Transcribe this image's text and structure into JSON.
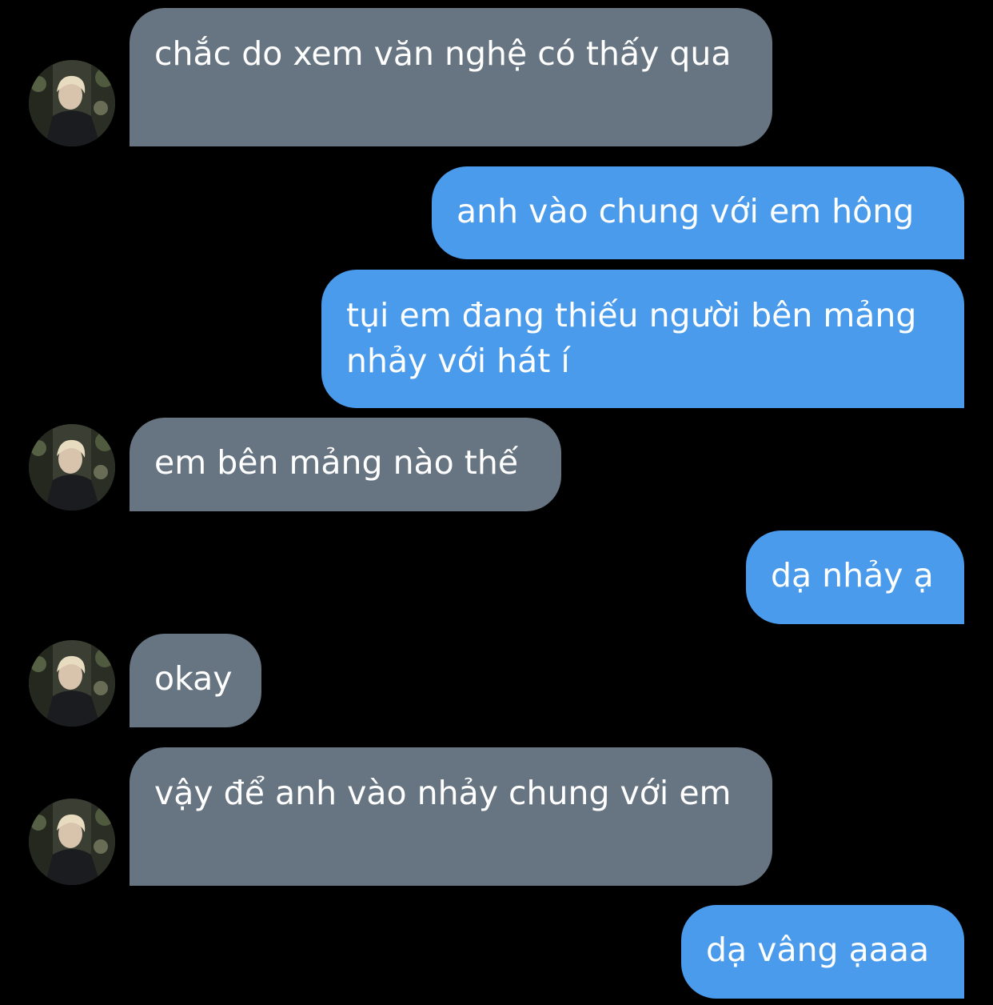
{
  "messages": [
    {
      "side": "incoming",
      "text": "chắc do xem văn nghệ có thấy qua"
    },
    {
      "side": "outgoing",
      "text": "anh vào chung với em hông"
    },
    {
      "side": "outgoing",
      "text": "tụi em đang thiếu người bên mảng nhảy với hát í"
    },
    {
      "side": "incoming",
      "text": "em bên mảng nào thế"
    },
    {
      "side": "outgoing",
      "text": "dạ nhảy ạ"
    },
    {
      "side": "incoming",
      "text": "okay"
    },
    {
      "side": "incoming",
      "text": "vậy để anh vào nhảy chung với em"
    },
    {
      "side": "outgoing",
      "text": "dạ vâng ạaaa"
    }
  ],
  "colors": {
    "background": "#000000",
    "incoming_bubble": "#677582",
    "outgoing_bubble": "#4a9beb",
    "text": "#ffffff"
  },
  "icons": {
    "avatar": "user-avatar-photo"
  }
}
